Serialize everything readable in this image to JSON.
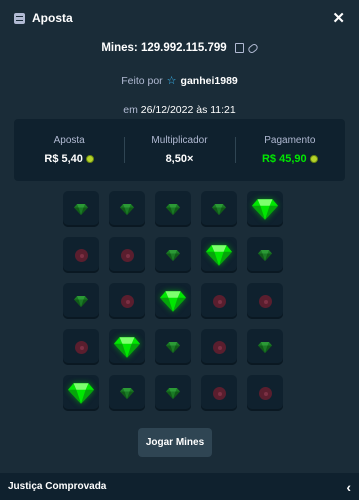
{
  "header": {
    "title": "Aposta",
    "icon": "bet-slip-icon",
    "close_icon": "close-icon"
  },
  "mines_line": {
    "label": "Mines: 129.992.115.799",
    "icons": [
      "copy-icon",
      "link-icon"
    ]
  },
  "by_line": {
    "prefix": "Feito por",
    "icon": "star-icon",
    "user": "ganhei1989"
  },
  "date_line": {
    "prefix": "em",
    "value": "26/12/2022 às 11:21"
  },
  "stats": {
    "bet": {
      "label": "Aposta",
      "value": "R$ 5,40"
    },
    "multiplier": {
      "label": "Multiplicador",
      "value": "8,50×"
    },
    "payout": {
      "label": "Pagamento",
      "value": "R$ 45,90"
    }
  },
  "colors": {
    "background": "#1a2c38",
    "panel": "#0f212e",
    "accent_green": "#00e701",
    "mine": "#5a1e2e"
  },
  "grid": {
    "rows": [
      [
        "gem",
        "gem",
        "gem",
        "gem",
        "gem-revealed"
      ],
      [
        "mine",
        "mine",
        "gem",
        "gem-revealed",
        "gem"
      ],
      [
        "gem",
        "mine",
        "gem-revealed",
        "mine",
        "mine"
      ],
      [
        "mine",
        "gem-revealed",
        "gem",
        "mine",
        "gem"
      ],
      [
        "gem-revealed",
        "gem",
        "gem",
        "mine",
        "mine"
      ]
    ]
  },
  "play_button": {
    "label": "Jogar Mines"
  },
  "footer": {
    "label": "Justiça Comprovada",
    "icon": "chevron-left-icon"
  }
}
